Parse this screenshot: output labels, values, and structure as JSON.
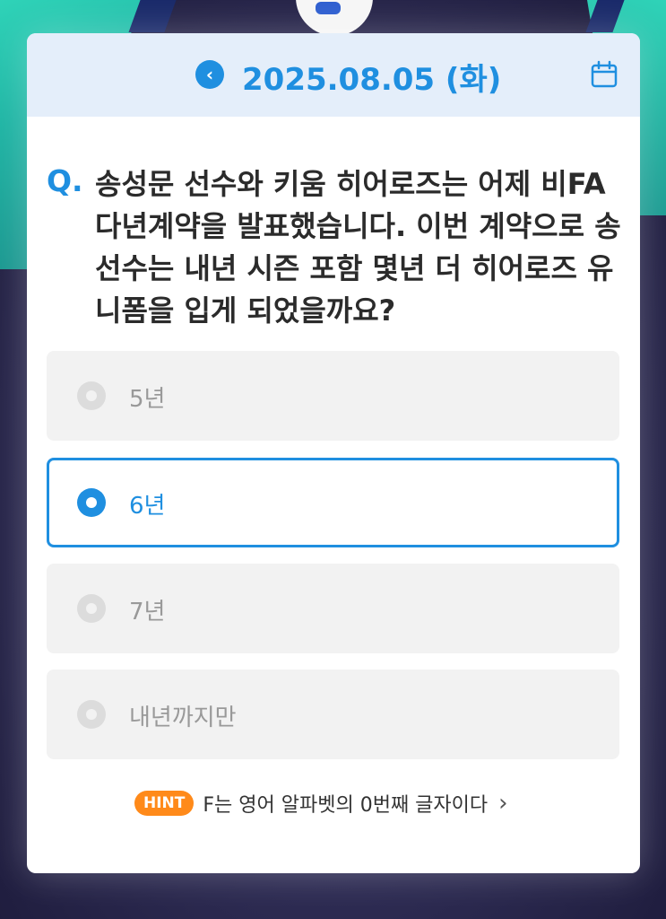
{
  "header": {
    "date": "2025.08.05 (화)",
    "back_icon": "chevron-left-icon",
    "calendar_icon": "calendar-icon"
  },
  "question": {
    "marker": "Q.",
    "text": "송성문 선수와 키움 히어로즈는 어제 비FA 다년계약을 발표했습니다. 이번 계약으로 송 선수는 내년 시즌 포함 몇년 더 히어로즈 유니폼을 입게 되었을까요?"
  },
  "options": [
    {
      "label": "5년",
      "selected": false
    },
    {
      "label": "6년",
      "selected": true
    },
    {
      "label": "7년",
      "selected": false
    },
    {
      "label": "내년까지만",
      "selected": false
    }
  ],
  "hint": {
    "badge": "HINT",
    "text": "F는 영어 알파벳의 0번째 글자이다",
    "chevron": "›"
  },
  "colors": {
    "accent": "#1f8fe0",
    "hint_badge": "#ff8a1a",
    "header_bg": "#e4eefa"
  }
}
